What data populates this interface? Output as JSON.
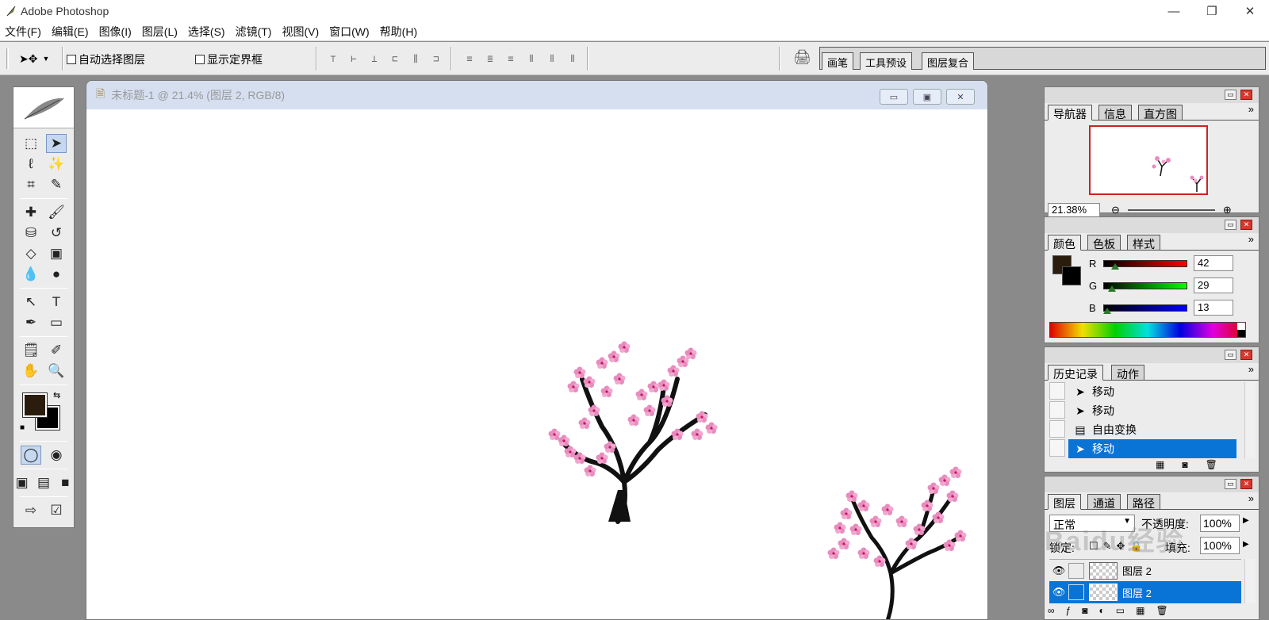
{
  "window": {
    "title": "Adobe Photoshop",
    "minimize": "—",
    "restore": "❐",
    "close": "✕"
  },
  "menu": [
    "文件(F)",
    "编辑(E)",
    "图像(I)",
    "图层(L)",
    "选择(S)",
    "滤镜(T)",
    "视图(V)",
    "窗口(W)",
    "帮助(H)"
  ],
  "options": {
    "auto_select": "自动选择图层",
    "show_bounds": "显示定界框",
    "well_tabs": [
      "画笔",
      "工具预设",
      "图层复合"
    ]
  },
  "document": {
    "title": "未标题-1 @ 21.4% (图层 2, RGB/8)"
  },
  "colors": {
    "foreground": "#2a1d0d",
    "background": "#000000",
    "selection": "#0a74d6",
    "blossom": "#e88cbf",
    "trunk": "#111111"
  },
  "navigator": {
    "tabs": [
      "导航器",
      "信息",
      "直方图"
    ],
    "zoom": "21.38%"
  },
  "color_panel": {
    "tabs": [
      "颜色",
      "色板",
      "样式"
    ],
    "r_label": "R",
    "g_label": "G",
    "b_label": "B",
    "r": "42",
    "g": "29",
    "b": "13"
  },
  "history": {
    "tabs": [
      "历史记录",
      "动作"
    ],
    "items": [
      "移动",
      "移动",
      "自由变换",
      "移动"
    ]
  },
  "layers": {
    "tabs": [
      "图层",
      "通道",
      "路径"
    ],
    "blend_mode": "正常",
    "opacity_label": "不透明度:",
    "opacity": "100%",
    "lock_label": "锁定:",
    "fill_label": "填充:",
    "fill": "100%",
    "layer_names": [
      "图层 2",
      "图层 2"
    ]
  },
  "watermark": "Baidu经验"
}
